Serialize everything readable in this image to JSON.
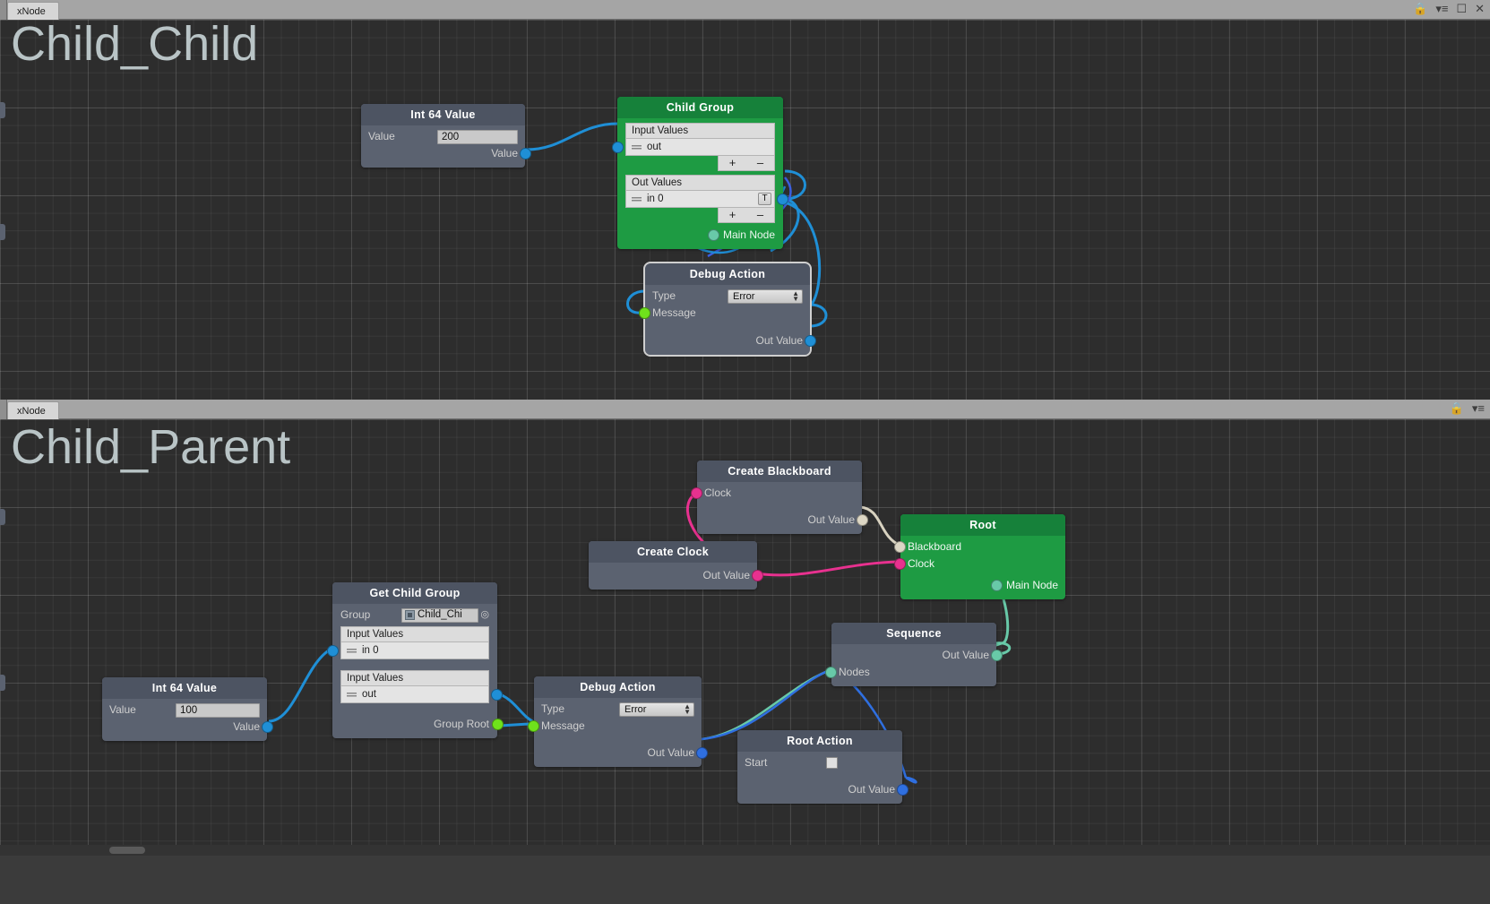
{
  "window": {
    "icons": [
      "lock-icon",
      "menu-icon",
      "maximize-icon",
      "close-icon"
    ]
  },
  "panels": [
    {
      "tab_label": "xNode",
      "graph_title": "Child_Child",
      "nodes": [
        {
          "id": "int64-top",
          "title": "Int 64 Value",
          "value_label": "Value",
          "value": "200",
          "out_label": "Value"
        },
        {
          "id": "child-group",
          "title": "Child Group",
          "sections": [
            {
              "header": "Input Values",
              "item": "out"
            },
            {
              "header": "Out Values",
              "item": "in 0",
              "item_button": "T"
            }
          ],
          "add_label": "+",
          "remove_label": "–",
          "main_node_label": "Main Node"
        },
        {
          "id": "debug-action-top",
          "title": "Debug Action",
          "type_label": "Type",
          "type_value": "Error",
          "message_label": "Message",
          "out_label": "Out Value"
        }
      ]
    },
    {
      "tab_label": "xNode",
      "graph_title": "Child_Parent",
      "nodes": [
        {
          "id": "int64-bottom",
          "title": "Int 64 Value",
          "value_label": "Value",
          "value": "100",
          "out_label": "Value"
        },
        {
          "id": "get-child-group",
          "title": "Get Child Group",
          "group_label": "Group",
          "group_value": "Child_Chi",
          "sections": [
            {
              "header": "Input Values",
              "item": "in 0"
            },
            {
              "header": "Input Values",
              "item": "out"
            }
          ],
          "out_label": "Group Root"
        },
        {
          "id": "create-blackboard",
          "title": "Create Blackboard",
          "in_label": "Clock",
          "out_label": "Out Value"
        },
        {
          "id": "create-clock",
          "title": "Create Clock",
          "out_label": "Out Value"
        },
        {
          "id": "root",
          "title": "Root",
          "blackboard_label": "Blackboard",
          "clock_label": "Clock",
          "main_node_label": "Main Node"
        },
        {
          "id": "sequence",
          "title": "Sequence",
          "out_label": "Out Value",
          "nodes_label": "Nodes"
        },
        {
          "id": "debug-action-bottom",
          "title": "Debug Action",
          "type_label": "Type",
          "type_value": "Error",
          "message_label": "Message",
          "out_label": "Out Value"
        },
        {
          "id": "root-action",
          "title": "Root Action",
          "start_label": "Start",
          "start_checked": false,
          "out_label": "Out Value"
        }
      ]
    }
  ],
  "colors": {
    "group_green": "#1e9b43",
    "node_gray": "#5b6270",
    "port_blue": "#1f8fd6",
    "port_green": "#6fe21b",
    "port_pink": "#e8318f",
    "port_teal": "#68c9a8",
    "port_beige": "#ddd7c5",
    "wire_blue": "#2f6fe0",
    "background": "#2d2d2d"
  }
}
